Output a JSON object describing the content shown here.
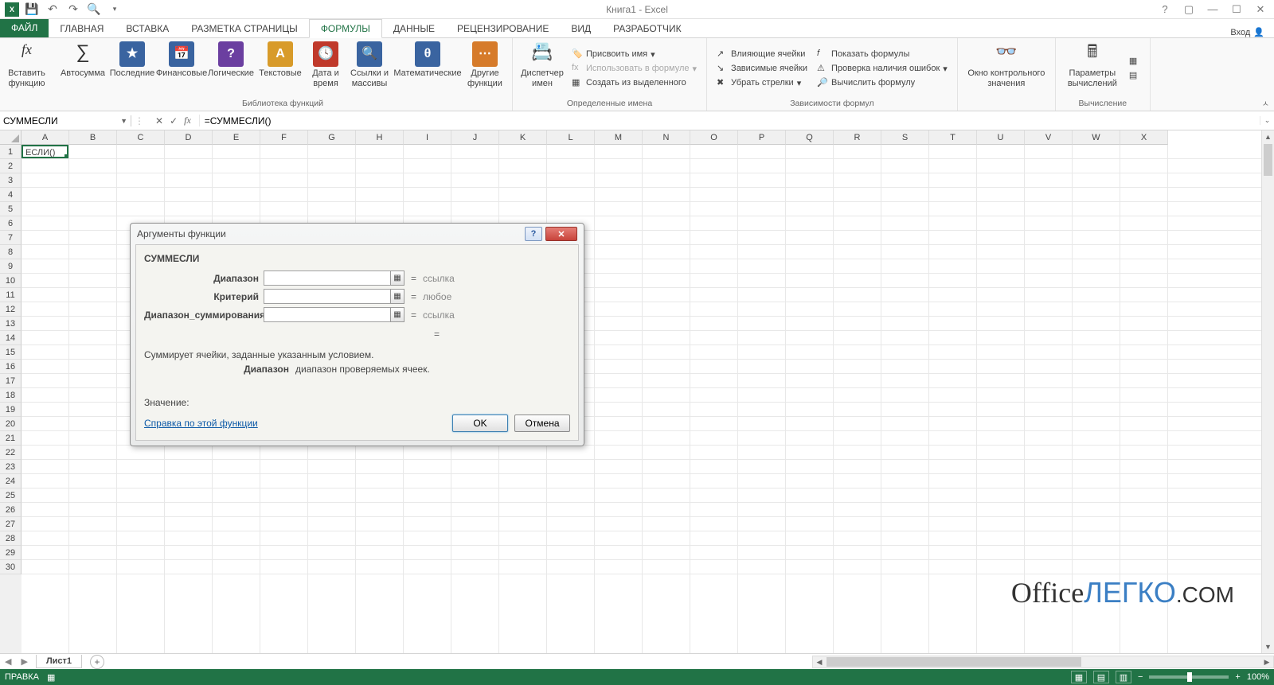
{
  "app_title": "Книга1 - Excel",
  "login": "Вход",
  "tabs": {
    "file": "ФАЙЛ",
    "items": [
      "ГЛАВНАЯ",
      "ВСТАВКА",
      "РАЗМЕТКА СТРАНИЦЫ",
      "ФОРМУЛЫ",
      "ДАННЫЕ",
      "РЕЦЕНЗИРОВАНИЕ",
      "ВИД",
      "РАЗРАБОТЧИК"
    ],
    "active_index": 3
  },
  "ribbon": {
    "insert_fn": "Вставить функцию",
    "lib": {
      "autosum": "Автосумма",
      "recent": "Последние",
      "financial": "Финансовые",
      "logical": "Логические",
      "text": "Текстовые",
      "datetime": "Дата и время",
      "lookup": "Ссылки и массивы",
      "math": "Математические",
      "more": "Другие функции",
      "group_label": "Библиотека функций"
    },
    "names": {
      "manager": "Диспетчер имен",
      "define": "Присвоить имя",
      "use": "Использовать в формуле",
      "create": "Создать из выделенного",
      "group_label": "Определенные имена"
    },
    "audit": {
      "precedents": "Влияющие ячейки",
      "dependents": "Зависимые ячейки",
      "remove": "Убрать стрелки",
      "show": "Показать формулы",
      "check": "Проверка наличия ошибок",
      "eval": "Вычислить формулу",
      "group_label": "Зависимости формул"
    },
    "watch": "Окно контрольного значения",
    "calc": {
      "options": "Параметры вычислений",
      "group_label": "Вычисление"
    }
  },
  "namebox_value": "СУММЕСЛИ",
  "formula_value": "=СУММЕСЛИ()",
  "active_cell_value": "ЕСЛИ()",
  "columns": [
    "A",
    "B",
    "C",
    "D",
    "E",
    "F",
    "G",
    "H",
    "I",
    "J",
    "K",
    "L",
    "M",
    "N",
    "O",
    "P",
    "Q",
    "R",
    "S",
    "T",
    "U",
    "V",
    "W",
    "X"
  ],
  "rows": [
    "1",
    "2",
    "3",
    "4",
    "5",
    "6",
    "7",
    "8",
    "9",
    "10",
    "11",
    "12",
    "13",
    "14",
    "15",
    "16",
    "17",
    "18",
    "19",
    "20",
    "21",
    "22",
    "23",
    "24",
    "25",
    "26",
    "27",
    "28",
    "29",
    "30"
  ],
  "sheet_tab": "Лист1",
  "status": "ПРАВКА",
  "zoom": "100%",
  "dialog": {
    "title": "Аргументы функции",
    "fn": "СУММЕСЛИ",
    "args": [
      {
        "label": "Диапазон",
        "hint": "ссылка"
      },
      {
        "label": "Критерий",
        "hint": "любое"
      },
      {
        "label": "Диапазон_суммирования",
        "hint": "ссылка"
      }
    ],
    "desc": "Суммирует ячейки, заданные указанным условием.",
    "arg_name": "Диапазон",
    "arg_desc": "диапазон проверяемых ячеек.",
    "value_label": "Значение:",
    "help_link": "Справка по этой функции",
    "ok": "OK",
    "cancel": "Отмена"
  },
  "watermark": {
    "a": "Office",
    "b": "ЛЕГКО",
    "c": ".COM"
  }
}
